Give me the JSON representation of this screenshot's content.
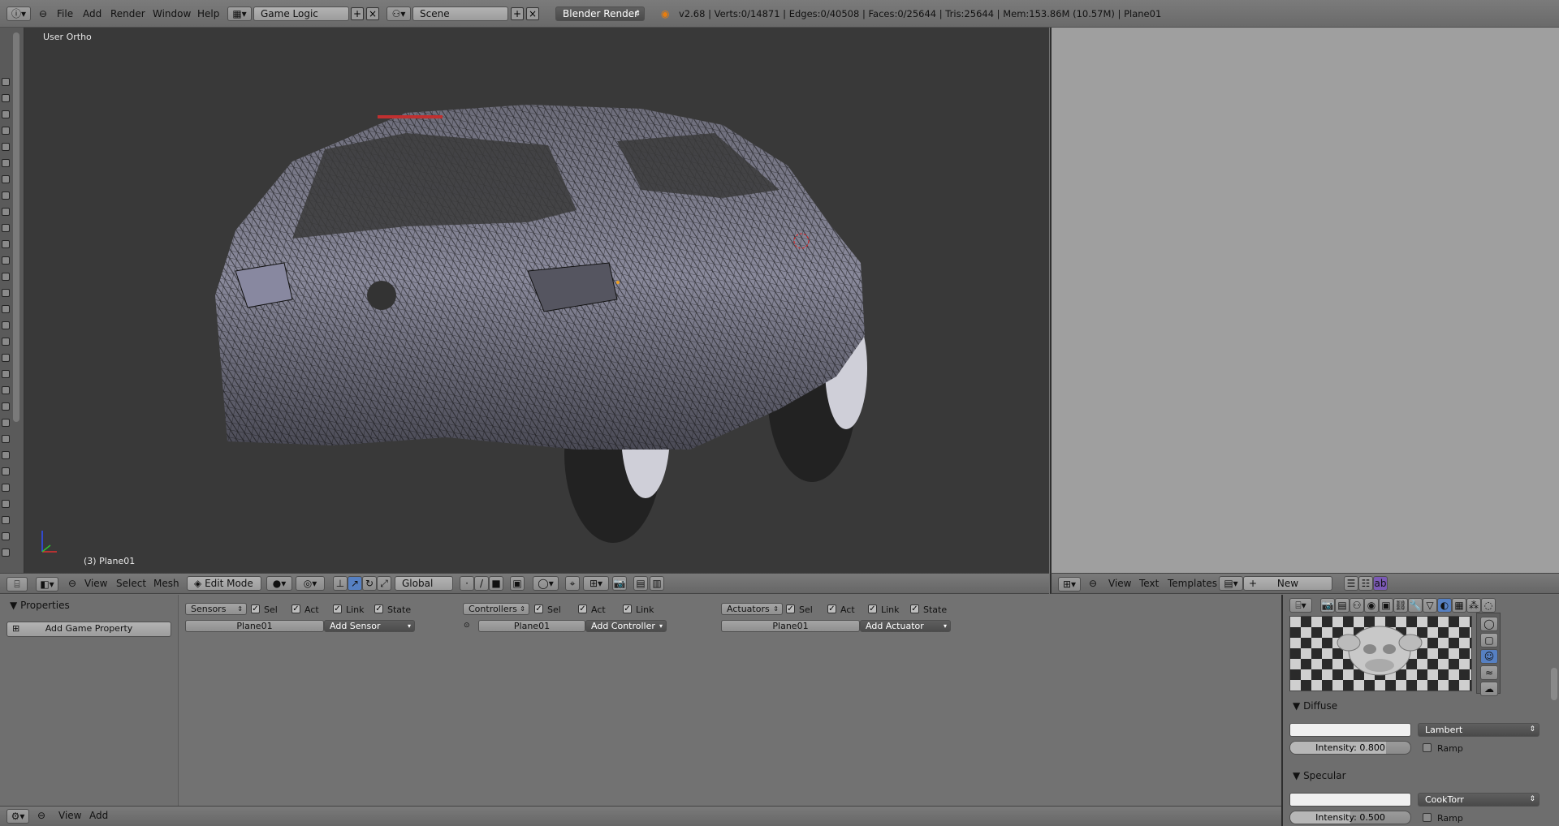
{
  "topbar": {
    "menus": [
      "File",
      "Add",
      "Render",
      "Window",
      "Help"
    ],
    "screen_layout": "Game Logic",
    "scene": "Scene",
    "render_engine": "Blender Render",
    "stats": "v2.68 | Verts:0/14871 | Edges:0/40508 | Faces:0/25644 | Tris:25644 | Mem:153.86M (10.57M) | Plane01"
  },
  "viewport": {
    "view_label": "User Ortho",
    "object_label": "(3) Plane01"
  },
  "viewport_header": {
    "menus": [
      "View",
      "Select",
      "Mesh"
    ],
    "mode": "Edit Mode",
    "orientation": "Global"
  },
  "text_editor_header": {
    "menus": [
      "View",
      "Text",
      "Templates"
    ],
    "new_label": "New"
  },
  "logic": {
    "properties_title": "Properties",
    "add_game_property": "Add Game Property",
    "sensors": {
      "label": "Sensors",
      "filters": [
        "Sel",
        "Act",
        "Link",
        "State"
      ],
      "object": "Plane01",
      "add": "Add Sensor"
    },
    "controllers": {
      "label": "Controllers",
      "filters": [
        "Sel",
        "Act",
        "Link"
      ],
      "object": "Plane01",
      "add": "Add Controller"
    },
    "actuators": {
      "label": "Actuators",
      "filters": [
        "Sel",
        "Act",
        "Link",
        "State"
      ],
      "object": "Plane01",
      "add": "Add Actuator"
    }
  },
  "material": {
    "diffuse": {
      "title": "Diffuse",
      "shader": "Lambert",
      "intensity_label": "Intensity: 0.800",
      "intensity": 0.8,
      "ramp": "Ramp"
    },
    "specular": {
      "title": "Specular",
      "shader": "CookTorr",
      "intensity_label": "Intensity: 0.500",
      "intensity": 0.5,
      "ramp": "Ramp"
    }
  },
  "bottom_header": {
    "menus": [
      "View",
      "Add"
    ]
  }
}
